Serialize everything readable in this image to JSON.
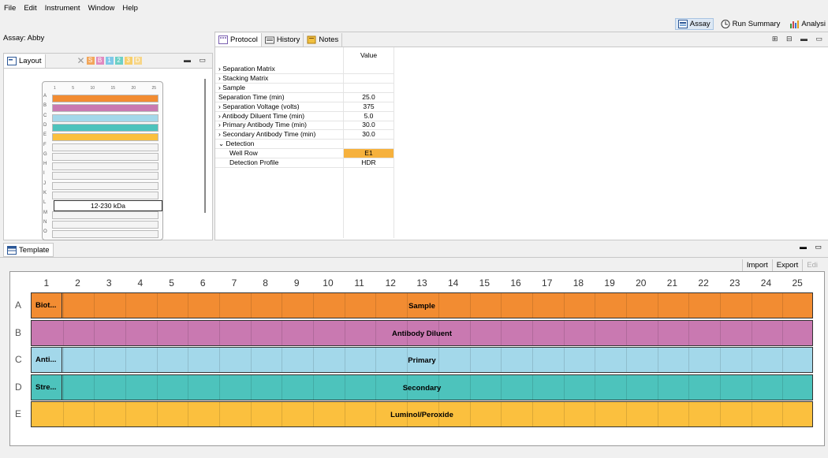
{
  "menu": [
    "File",
    "Edit",
    "Instrument",
    "Window",
    "Help"
  ],
  "perspectives": [
    {
      "label": "Assay",
      "icon": "assay-icon",
      "active": true
    },
    {
      "label": "Run Summary",
      "icon": "run-summary-icon",
      "active": false
    },
    {
      "label": "Analysi",
      "icon": "analysis-icon",
      "active": false
    }
  ],
  "assay_label": "Assay: Abby",
  "layout": {
    "tab": "Layout",
    "markers": [
      "S",
      "B",
      "1",
      "2",
      "3",
      "D"
    ],
    "rows": [
      "A",
      "B",
      "C",
      "D",
      "E",
      "F",
      "G",
      "H",
      "I",
      "J",
      "K",
      "L",
      "M",
      "N",
      "O"
    ],
    "size_label": "12-230 kDa",
    "col_ticks": [
      "1",
      "5",
      "10",
      "15",
      "20",
      "25"
    ]
  },
  "protocol": {
    "tabs": [
      "Protocol",
      "History",
      "Notes"
    ],
    "value_header": "Value",
    "rows": [
      {
        "name": "Separation Matrix",
        "value": "",
        "indent": 0,
        "arrow": ">"
      },
      {
        "name": "Stacking Matrix",
        "value": "",
        "indent": 0,
        "arrow": ">"
      },
      {
        "name": "Sample",
        "value": "",
        "indent": 0,
        "arrow": ">"
      },
      {
        "name": "Separation Time (min)",
        "value": "25.0",
        "indent": 0,
        "arrow": ""
      },
      {
        "name": "Separation Voltage (volts)",
        "value": "375",
        "indent": 0,
        "arrow": ">"
      },
      {
        "name": "Antibody Diluent Time (min)",
        "value": "5.0",
        "indent": 0,
        "arrow": ">"
      },
      {
        "name": "Primary Antibody Time (min)",
        "value": "30.0",
        "indent": 0,
        "arrow": ">"
      },
      {
        "name": "Secondary Antibody Time (min)",
        "value": "30.0",
        "indent": 0,
        "arrow": ">"
      },
      {
        "name": "Detection",
        "value": "",
        "indent": 0,
        "arrow": "v"
      },
      {
        "name": "Well Row",
        "value": "E1",
        "indent": 1,
        "arrow": "",
        "highlight": true
      },
      {
        "name": "Detection Profile",
        "value": "HDR",
        "indent": 1,
        "arrow": ""
      }
    ]
  },
  "template": {
    "tab": "Template",
    "buttons": [
      "Import",
      "Export",
      "Edi"
    ],
    "columns": [
      "1",
      "2",
      "3",
      "4",
      "5",
      "6",
      "7",
      "8",
      "9",
      "10",
      "11",
      "12",
      "13",
      "14",
      "15",
      "16",
      "17",
      "18",
      "19",
      "20",
      "21",
      "22",
      "23",
      "24",
      "25"
    ],
    "rows": [
      {
        "row": "A",
        "first": "Biot...",
        "label": "Sample",
        "color": "#f28c32"
      },
      {
        "row": "B",
        "first": "",
        "label": "Antibody Diluent",
        "color": "#c979b1"
      },
      {
        "row": "C",
        "first": "Anti...",
        "label": "Primary",
        "color": "#a3d8ea"
      },
      {
        "row": "D",
        "first": "Stre...",
        "label": "Secondary",
        "color": "#4dc3bc"
      },
      {
        "row": "E",
        "first": "",
        "label": "Luminol/Peroxide",
        "color": "#fbc03e"
      }
    ]
  },
  "colors": {
    "highlight": "#f6b13d",
    "active_tab": "#dde8f4"
  }
}
